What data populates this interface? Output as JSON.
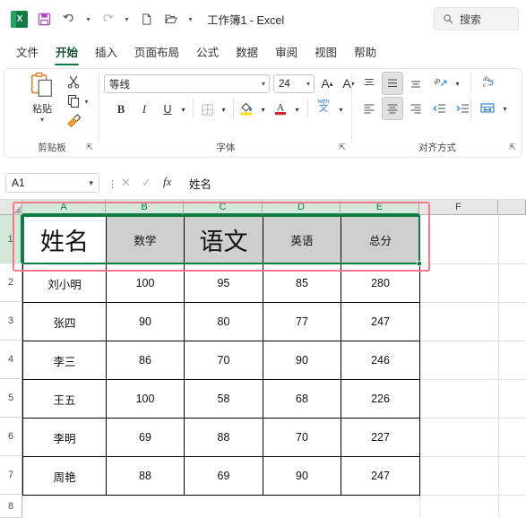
{
  "titlebar": {
    "app_icon": "excel-logo",
    "app_icon_letter": "X",
    "document_title": "工作簿1  -  Excel",
    "quick_access": [
      {
        "name": "save-icon",
        "glyph": "ὋE"
      },
      {
        "name": "undo-icon",
        "glyph": "↶"
      },
      {
        "name": "redo-icon",
        "glyph": "↷"
      },
      {
        "name": "new-file-icon",
        "glyph": "὜B"
      },
      {
        "name": "open-folder-icon",
        "glyph": "὜1"
      },
      {
        "name": "customize-qat-icon",
        "glyph": "⌄"
      }
    ],
    "search": {
      "placeholder": "搜索",
      "icon": "search-icon"
    }
  },
  "tabs": [
    {
      "label": "文件",
      "active": false
    },
    {
      "label": "开始",
      "active": true
    },
    {
      "label": "插入",
      "active": false
    },
    {
      "label": "页面布局",
      "active": false
    },
    {
      "label": "公式",
      "active": false
    },
    {
      "label": "数据",
      "active": false
    },
    {
      "label": "审阅",
      "active": false
    },
    {
      "label": "视图",
      "active": false
    },
    {
      "label": "帮助",
      "active": false
    }
  ],
  "ribbon": {
    "groups": [
      {
        "name": "clipboard",
        "label": "剪贴板"
      },
      {
        "name": "font",
        "label": "字体"
      },
      {
        "name": "alignment",
        "label": "对齐方式"
      }
    ],
    "clipboard": {
      "paste_label": "粘贴",
      "cut_icon": "scissors-icon",
      "copy_icon": "copy-icon",
      "format_painter_icon": "format-painter-icon"
    },
    "font": {
      "font_name": "等线",
      "font_size": "24",
      "grow_font_icon": "grow-font-icon",
      "shrink_font_icon": "shrink-font-icon",
      "bold_label": "B",
      "italic_label": "I",
      "underline_label": "U",
      "borders_icon": "borders-icon",
      "fill_color_icon": "fill-color-icon",
      "font_color_icon": "font-color-icon",
      "font_color_swatch": "#d9232e",
      "phonetic_icon": "phonetic-guide-icon",
      "phonetic_label_top": "wén",
      "phonetic_label_bottom": "文"
    },
    "alignment": {
      "align_top_icon": "align-top-icon",
      "align_middle_icon": "align-middle-icon",
      "align_bottom_icon": "align-bottom-icon",
      "orientation_icon": "text-orientation-icon",
      "align_left_icon": "align-left-icon",
      "align_center_icon": "align-center-icon",
      "align_right_icon": "align-right-icon",
      "decrease_indent_icon": "decrease-indent-icon",
      "increase_indent_icon": "increase-indent-icon",
      "wrap_text_icon": "wrap-text-icon",
      "merge_cells_icon": "merge-and-center-icon"
    }
  },
  "formula_bar": {
    "name_box_value": "A1",
    "cancel_icon": "cancel-icon",
    "confirm_icon": "confirm-icon",
    "function_icon": "fx",
    "formula_value": "姓名"
  },
  "sheet": {
    "column_headers": [
      "A",
      "B",
      "C",
      "D",
      "E",
      "F"
    ],
    "selected_columns": [
      "A",
      "B",
      "C",
      "D",
      "E"
    ],
    "row_headers": [
      "1",
      "2",
      "3",
      "4",
      "5",
      "6",
      "7",
      "8"
    ],
    "selected_rows": [
      "1"
    ],
    "active_cell": "A1",
    "selection_range": "A1:E1",
    "header_row": [
      "姓名",
      "数学",
      "语文",
      "英语",
      "总分"
    ],
    "header_row_large_font": [
      "姓名",
      "语文"
    ],
    "rows": [
      [
        "刘小明",
        "100",
        "95",
        "85",
        "280"
      ],
      [
        "张四",
        "90",
        "80",
        "77",
        "247"
      ],
      [
        "李三",
        "86",
        "70",
        "90",
        "246"
      ],
      [
        "王五",
        "100",
        "58",
        "68",
        "226"
      ],
      [
        "李明",
        "69",
        "88",
        "70",
        "227"
      ],
      [
        "周艳",
        "88",
        "69",
        "90",
        "247"
      ]
    ],
    "annotation": {
      "name": "red-highlight-rectangle",
      "color": "#f4798c"
    },
    "selection_color": "#107c41",
    "selected_fill": "#cfcfcf"
  }
}
